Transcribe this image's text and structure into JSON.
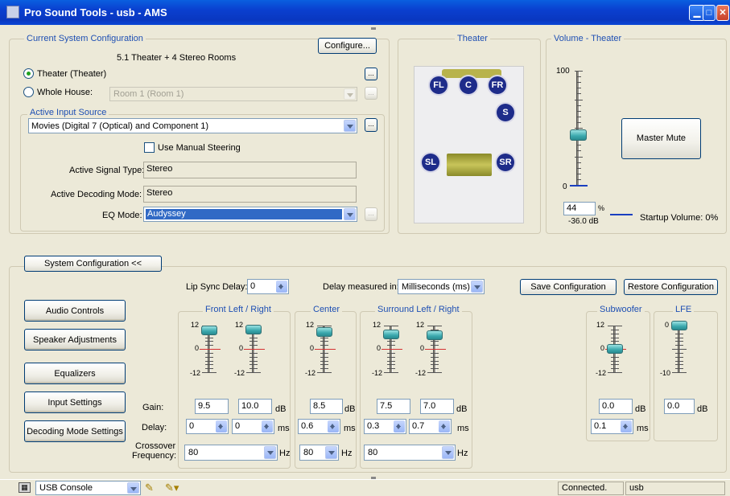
{
  "window": {
    "title": "Pro Sound Tools - usb - AMS"
  },
  "config": {
    "legend": "Current System Configuration",
    "configure_label": "Configure...",
    "summary": "5.1 Theater + 4 Stereo Rooms",
    "theater_radio": "Theater (Theater)",
    "wholehouse_radio": "Whole House:",
    "room_value": "Room 1 (Room 1)",
    "ellipsis": "...",
    "input_legend": "Active Input Source",
    "input_value": "Movies (Digital 7 (Optical) and Component 1)",
    "manual_steering": "Use Manual Steering",
    "signal_type_label": "Active Signal Type:",
    "signal_type_value": "Stereo",
    "decoding_label": "Active Decoding Mode:",
    "decoding_value": "Stereo",
    "eq_label": "EQ Mode:",
    "eq_value": "Audyssey"
  },
  "theater": {
    "legend": "Theater",
    "speakers": {
      "fl": "FL",
      "c": "C",
      "fr": "FR",
      "s": "S",
      "sl": "SL",
      "sr": "SR"
    }
  },
  "volume": {
    "legend": "Volume - Theater",
    "max": "100",
    "min": "0",
    "value": "44",
    "level": 0.44,
    "unit": "%",
    "db": "-36.0 dB",
    "master_mute": "Master Mute",
    "startup": "Startup Volume: 0%"
  },
  "sysconfig": {
    "toggle_label": "System Configuration  <<",
    "lip_sync_label": "Lip Sync Delay:",
    "lip_sync_value": "0",
    "delay_unit_label": "Delay measured in:",
    "delay_unit_value": "Milliseconds (ms)",
    "save": "Save Configuration",
    "restore": "Restore Configuration"
  },
  "nav": {
    "audio": "Audio Controls",
    "speaker": "Speaker Adjustments",
    "eq": "Equalizers",
    "input": "Input Settings",
    "decoding": "Decoding Mode Settings"
  },
  "rows": {
    "gain": "Gain:",
    "delay": "Delay:",
    "crossover_1": "Crossover",
    "crossover_2": "Frequency:"
  },
  "groups": {
    "front": "Front Left / Right",
    "center": "Center",
    "surround": "Surround Left / Right",
    "sub": "Subwoofer",
    "lfe": "LFE"
  },
  "scale": {
    "top": "12",
    "mid": "0",
    "bot": "-12",
    "lfe_top": "0",
    "lfe_bot": "-10"
  },
  "channels": {
    "fl": {
      "gain": "9.5",
      "delay": "0"
    },
    "fr": {
      "gain": "10.0",
      "delay": "0"
    },
    "c": {
      "gain": "8.5",
      "delay": "0.6"
    },
    "sl": {
      "gain": "7.5",
      "delay": "0.3"
    },
    "sr": {
      "gain": "7.0",
      "delay": "0.7"
    },
    "sub": {
      "gain": "0.0",
      "delay": "0.1"
    },
    "lfe": {
      "gain": "0.0"
    }
  },
  "crossover": {
    "front": "80",
    "center": "80",
    "surround": "80"
  },
  "units": {
    "db": "dB",
    "ms": "ms",
    "hz": "Hz"
  },
  "status": {
    "console": "USB Console",
    "connection": "Connected.",
    "port": "usb"
  },
  "colors": {
    "title_bar": "#0a3fcf",
    "legend": "#1e4fb3",
    "speaker": "#1e2c8a",
    "selected": "#316ac5"
  }
}
